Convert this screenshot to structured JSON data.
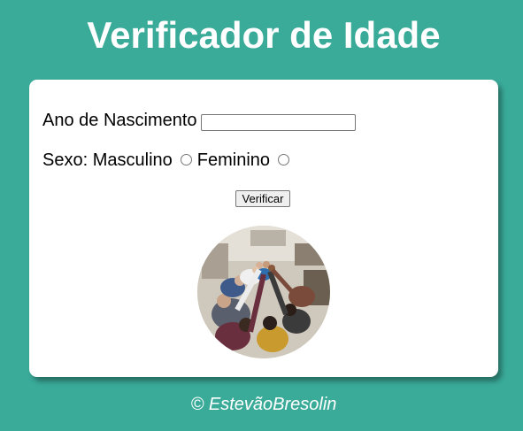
{
  "header": {
    "title": "Verificador de Idade"
  },
  "form": {
    "birth_year_label": "Ano de Nascimento",
    "birth_year_value": "",
    "sex_label": "Sexo:",
    "options": [
      {
        "label": "Masculino",
        "checked": false
      },
      {
        "label": "Feminino",
        "checked": false
      }
    ],
    "submit_label": "Verificar"
  },
  "result": {
    "image_icon": "group-high-five-photo"
  },
  "footer": {
    "copyright": "© EstevãoBresolin"
  },
  "colors": {
    "background": "#3aab99",
    "card": "#ffffff",
    "text": "#000000",
    "title": "#ffffff"
  }
}
